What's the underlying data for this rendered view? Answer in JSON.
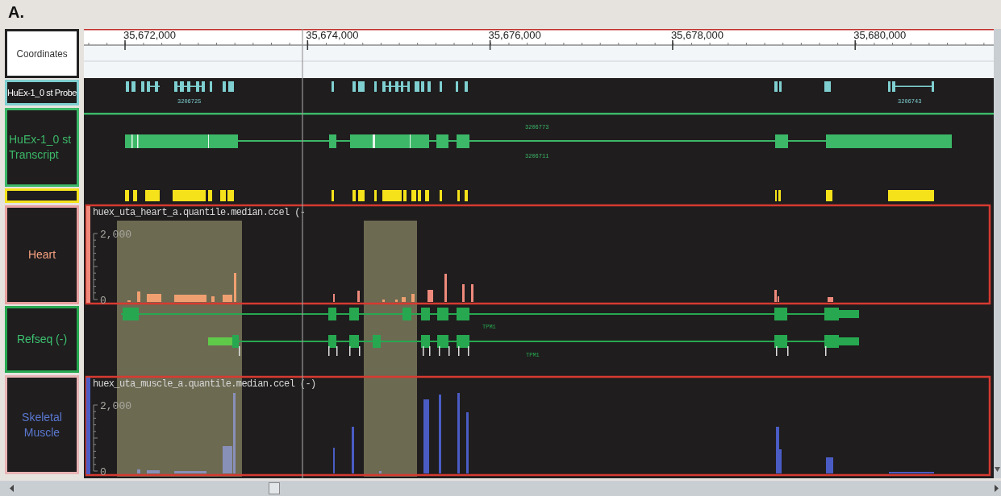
{
  "figure_label": "A.",
  "ruler": {
    "ticks": [
      "35,672,000",
      "35,674,000",
      "35,676,000",
      "35,678,000",
      "35,680,000"
    ]
  },
  "tracks": [
    {
      "kind": "ruler",
      "label": "Coordinates",
      "color": "#222222"
    },
    {
      "kind": "probes",
      "label": "HuEx-1_0 st Probe",
      "color": "#7fcfd0",
      "feature_labels": [
        "3206725",
        "3206743"
      ]
    },
    {
      "kind": "transcripts",
      "label": "HuEx-1_0 st Transcript",
      "color": "#3cb868",
      "feature_labels": [
        "3206773",
        "3206711"
      ]
    },
    {
      "kind": "exons",
      "color": "#f5e21a"
    },
    {
      "kind": "signal",
      "label": "Heart",
      "color": "#e8a0a0",
      "title": "huex_uta_heart_a.quantile.median.ccel (-",
      "axis_labels": [
        "2,000",
        "0"
      ]
    },
    {
      "kind": "genes",
      "label": "Refseq (-)",
      "color": "#27a850",
      "feature_labels": [
        "TPM1",
        "TPM1"
      ]
    },
    {
      "kind": "signal",
      "label": "Skeletal Muscle",
      "color": "#e8b4b4",
      "title": "huex_uta_muscle_a.quantile.median.ccel (-)",
      "axis_labels": [
        "2,000",
        "0"
      ]
    }
  ]
}
